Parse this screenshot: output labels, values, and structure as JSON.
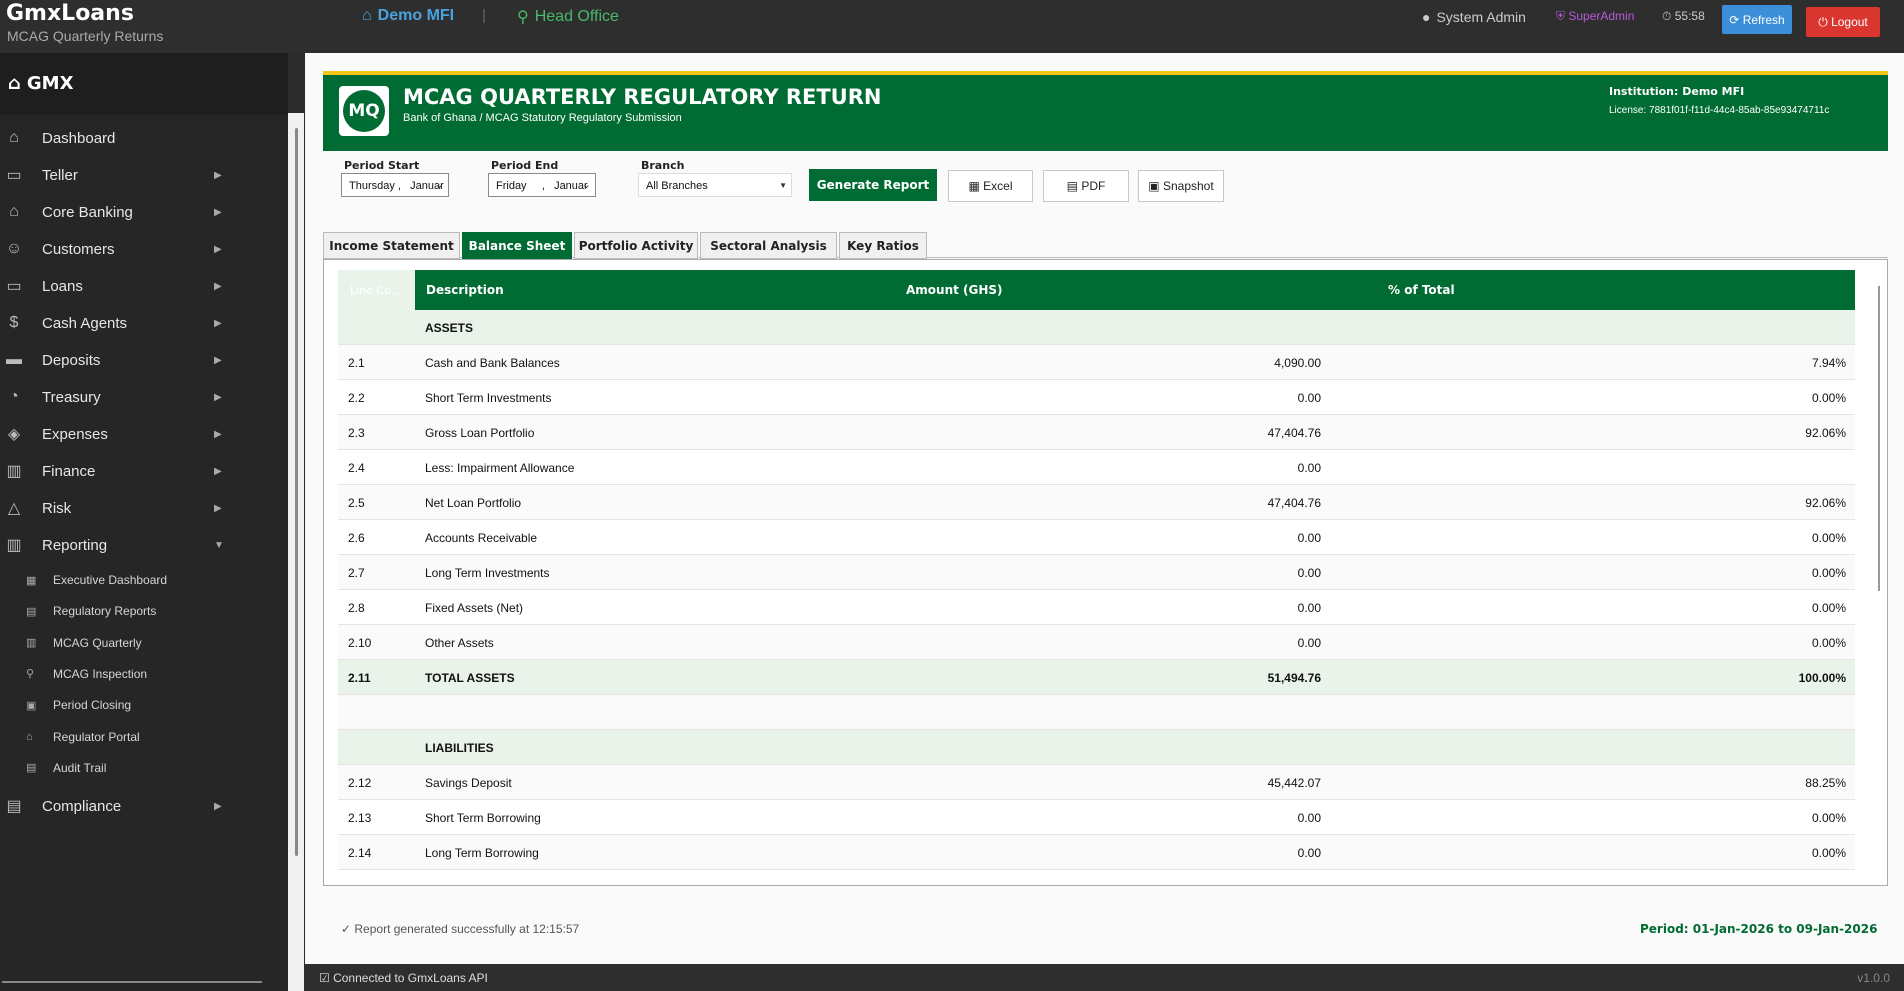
{
  "app": {
    "brand": "GmxLoans",
    "subtitle": "MCAG Quarterly Returns"
  },
  "topbar": {
    "org": "Demo MFI",
    "separator": "|",
    "office": "Head Office",
    "user": "System Admin",
    "role": "SuperAdmin",
    "timer": "55:58",
    "refresh_label": "Refresh",
    "logout_label": "Logout"
  },
  "sidebar": {
    "title": "GMX",
    "items": [
      {
        "label": "Dashboard",
        "icon": "home-icon",
        "arrow": ""
      },
      {
        "label": "Teller",
        "icon": "teller-icon",
        "arrow": "▶"
      },
      {
        "label": "Core Banking",
        "icon": "bank-icon",
        "arrow": "▶"
      },
      {
        "label": "Customers",
        "icon": "users-icon",
        "arrow": "▶"
      },
      {
        "label": "Loans",
        "icon": "card-icon",
        "arrow": "▶"
      },
      {
        "label": "Cash Agents",
        "icon": "money-bag-icon",
        "arrow": "▶"
      },
      {
        "label": "Deposits",
        "icon": "deposit-icon",
        "arrow": "▶"
      },
      {
        "label": "Treasury",
        "icon": "treasury-icon",
        "arrow": "▶"
      },
      {
        "label": "Expenses",
        "icon": "expense-icon",
        "arrow": "▶"
      },
      {
        "label": "Finance",
        "icon": "finance-icon",
        "arrow": "▶"
      },
      {
        "label": "Risk",
        "icon": "warning-icon",
        "arrow": "▶"
      },
      {
        "label": "Reporting",
        "icon": "chart-icon",
        "arrow": "▼"
      }
    ],
    "sub_items": [
      {
        "label": "Executive Dashboard",
        "icon": "dashboard-icon"
      },
      {
        "label": "Regulatory Reports",
        "icon": "report-icon"
      },
      {
        "label": "MCAG Quarterly",
        "icon": "bar-chart-icon"
      },
      {
        "label": "MCAG Inspection",
        "icon": "magnifier-icon"
      },
      {
        "label": "Period Closing",
        "icon": "calendar-icon"
      },
      {
        "label": "Regulator Portal",
        "icon": "building-icon"
      },
      {
        "label": "Audit Trail",
        "icon": "clipboard-icon"
      }
    ],
    "compliance": {
      "label": "Compliance",
      "icon": "compliance-icon",
      "arrow": "▶"
    }
  },
  "header": {
    "logo_text": "MQ",
    "title": "MCAG QUARTERLY REGULATORY RETURN",
    "subtitle": "Bank of Ghana / MCAG Statutory Regulatory Submission",
    "institution": "Institution: Demo MFI",
    "license": "License: 7881f01f-f11d-44c4-85ab-85e93474711c"
  },
  "filters": {
    "period_start_label": "Period Start",
    "period_start_value": "Thursday ,   Januar",
    "period_end_label": "Period End",
    "period_end_value": "Friday     ,   Januar",
    "branch_label": "Branch",
    "branch_value": "All Branches"
  },
  "actions": {
    "generate": "Generate Report",
    "excel": "Excel",
    "pdf": "PDF",
    "snapshot": "Snapshot"
  },
  "tabs": [
    "Income Statement",
    "Balance Sheet",
    "Portfolio Activity",
    "Sectoral Analysis",
    "Key Ratios"
  ],
  "active_tab": "Balance Sheet",
  "table": {
    "headers": [
      "Line Co...",
      "Description",
      "Amount (GHS)",
      "% of Total"
    ],
    "rows": [
      {
        "type": "section",
        "code": "",
        "desc": "ASSETS",
        "amount": "",
        "pct": ""
      },
      {
        "type": "row",
        "code": "2.1",
        "desc": "Cash and Bank Balances",
        "amount": "4,090.00",
        "pct": "7.94%"
      },
      {
        "type": "row",
        "code": "2.2",
        "desc": "Short Term Investments",
        "amount": "0.00",
        "pct": "0.00%"
      },
      {
        "type": "row",
        "code": "2.3",
        "desc": "Gross Loan Portfolio",
        "amount": "47,404.76",
        "pct": "92.06%"
      },
      {
        "type": "row",
        "code": "2.4",
        "desc": "Less: Impairment Allowance",
        "amount": "0.00",
        "pct": ""
      },
      {
        "type": "row",
        "code": "2.5",
        "desc": "Net Loan Portfolio",
        "amount": "47,404.76",
        "pct": "92.06%"
      },
      {
        "type": "row",
        "code": "2.6",
        "desc": "Accounts Receivable",
        "amount": "0.00",
        "pct": "0.00%"
      },
      {
        "type": "row",
        "code": "2.7",
        "desc": "Long Term Investments",
        "amount": "0.00",
        "pct": "0.00%"
      },
      {
        "type": "row",
        "code": "2.8",
        "desc": "Fixed Assets (Net)",
        "amount": "0.00",
        "pct": "0.00%"
      },
      {
        "type": "row",
        "code": "2.10",
        "desc": "Other Assets",
        "amount": "0.00",
        "pct": "0.00%"
      },
      {
        "type": "total",
        "code": "2.11",
        "desc": "TOTAL ASSETS",
        "amount": "51,494.76",
        "pct": "100.00%"
      },
      {
        "type": "blank",
        "code": "",
        "desc": "",
        "amount": "",
        "pct": ""
      },
      {
        "type": "section",
        "code": "",
        "desc": "LIABILITIES",
        "amount": "",
        "pct": ""
      },
      {
        "type": "row",
        "code": "2.12",
        "desc": "Savings Deposit",
        "amount": "45,442.07",
        "pct": "88.25%"
      },
      {
        "type": "row",
        "code": "2.13",
        "desc": "Short Term Borrowing",
        "amount": "0.00",
        "pct": "0.00%"
      },
      {
        "type": "row",
        "code": "2.14",
        "desc": "Long Term Borrowing",
        "amount": "0.00",
        "pct": "0.00%"
      }
    ]
  },
  "status": {
    "message": "✓ Report generated successfully at 12:15:57",
    "period": "Period: 01-Jan-2026 to 09-Jan-2026"
  },
  "footer": {
    "connection": "☑ Connected to GmxLoans API",
    "version": "v1.0.0"
  },
  "colors": {
    "primary_green": "#006b32",
    "accent_gold": "#f5c518",
    "refresh_blue": "#3b8fd8",
    "logout_red": "#d9362f"
  }
}
